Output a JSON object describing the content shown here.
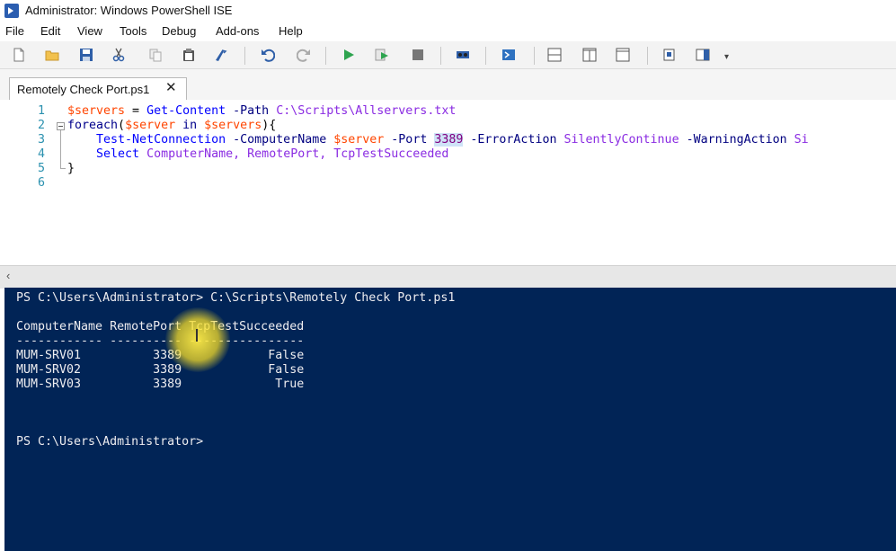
{
  "window": {
    "title": "Administrator: Windows PowerShell ISE"
  },
  "menu": [
    "File",
    "Edit",
    "View",
    "Tools",
    "Debug",
    "Add-ons",
    "Help"
  ],
  "toolbar": {
    "buttons": [
      "new-icon",
      "open-folder-icon",
      "save-icon",
      "cut-icon",
      "copy-icon",
      "paste-icon",
      "clear-icon",
      "undo-icon",
      "redo-icon",
      "run-icon",
      "run-selection-icon",
      "stop-icon",
      "remote-powershell-icon",
      "start-powershell-icon",
      "layout-script-top-icon",
      "layout-script-right-icon",
      "layout-script-max-icon",
      "show-commands-icon",
      "show-addon-icon"
    ]
  },
  "tab": {
    "label": "Remotely Check Port.ps1",
    "close": "✕"
  },
  "editor": {
    "line_numbers": [
      "1",
      "2",
      "3",
      "4",
      "5",
      "6"
    ],
    "lines": [
      [
        {
          "t": "$servers",
          "c": "var"
        },
        {
          "t": " = ",
          "c": "plain"
        },
        {
          "t": "Get-Content",
          "c": "cmd"
        },
        {
          "t": " ",
          "c": "plain"
        },
        {
          "t": "-Path",
          "c": "param"
        },
        {
          "t": " ",
          "c": "plain"
        },
        {
          "t": "C:\\Scripts\\Allservers.txt",
          "c": "str"
        }
      ],
      [
        {
          "t": "foreach",
          "c": "kw"
        },
        {
          "t": "(",
          "c": "plain"
        },
        {
          "t": "$server",
          "c": "var"
        },
        {
          "t": " ",
          "c": "plain"
        },
        {
          "t": "in",
          "c": "kw"
        },
        {
          "t": " ",
          "c": "plain"
        },
        {
          "t": "$servers",
          "c": "var"
        },
        {
          "t": "){",
          "c": "plain"
        }
      ],
      [
        {
          "t": "    Test-NetConnection",
          "c": "cmd"
        },
        {
          "t": " ",
          "c": "plain"
        },
        {
          "t": "-ComputerName",
          "c": "param"
        },
        {
          "t": " ",
          "c": "plain"
        },
        {
          "t": "$server",
          "c": "var"
        },
        {
          "t": " ",
          "c": "plain"
        },
        {
          "t": "-Port",
          "c": "param"
        },
        {
          "t": " ",
          "c": "plain"
        },
        {
          "t": "3389",
          "c": "num"
        },
        {
          "t": " ",
          "c": "plain"
        },
        {
          "t": "-ErrorAction",
          "c": "param"
        },
        {
          "t": " ",
          "c": "plain"
        },
        {
          "t": "SilentlyContinue",
          "c": "str"
        },
        {
          "t": " ",
          "c": "plain"
        },
        {
          "t": "-WarningAction",
          "c": "param"
        },
        {
          "t": " Si",
          "c": "str"
        }
      ],
      [
        {
          "t": "    Select",
          "c": "cmd"
        },
        {
          "t": " ",
          "c": "plain"
        },
        {
          "t": "ComputerName,",
          "c": "str"
        },
        {
          "t": " ",
          "c": "plain"
        },
        {
          "t": "RemotePort,",
          "c": "str"
        },
        {
          "t": " ",
          "c": "plain"
        },
        {
          "t": "TcpTestSucceeded",
          "c": "str"
        }
      ],
      [
        {
          "t": "}",
          "c": "plain"
        }
      ],
      []
    ]
  },
  "console": {
    "lines": [
      "PS C:\\Users\\Administrator> C:\\Scripts\\Remotely Check Port.ps1",
      "",
      "ComputerName RemotePort TcpTestSucceeded",
      "------------ ---------- ----------------",
      "MUM-SRV01          3389            False",
      "MUM-SRV02          3389            False",
      "MUM-SRV03          3389             True",
      "",
      "",
      "",
      "PS C:\\Users\\Administrator>"
    ]
  }
}
